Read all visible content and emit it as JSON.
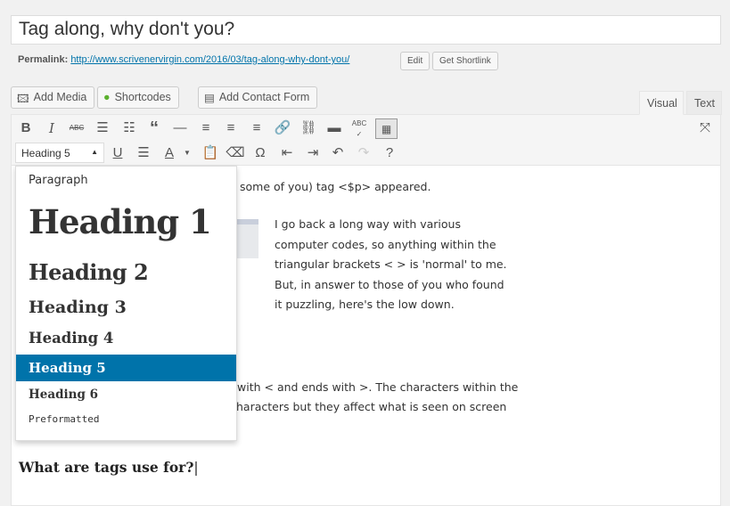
{
  "title": "Tag along, why don't you?",
  "permalink": {
    "label": "Permalink:",
    "url": "http://www.scrivenervirgin.com/2016/03/tag-along-why-dont-you/",
    "edit": "Edit",
    "shortlink": "Get Shortlink"
  },
  "media_buttons": {
    "add_media": "Add Media",
    "shortcodes": "Shortcodes",
    "contact_form": "Add Contact Form"
  },
  "tabs": {
    "visual": "Visual",
    "text": "Text"
  },
  "toolbar": {
    "format_selected": "Heading 5"
  },
  "format_menu": [
    "Paragraph",
    "Heading 1",
    "Heading 2",
    "Heading 3",
    "Heading 4",
    "Heading 5",
    "Heading 6",
    "Preformatted"
  ],
  "content": {
    "line1": "some of you) tag <$p> appeared.",
    "para": [
      "I go back a long way with various",
      "computer codes, so anything within the",
      "triangular brackets < > is 'normal' to me.",
      "But, in answer to those of you who found",
      "it puzzling, here's the low down."
    ],
    "line2": "with < and ends with >. The characters within the",
    "line3": "haracters but they affect what is seen on screen",
    "heading": "What are tags use for?"
  },
  "accent": "#0073aa"
}
